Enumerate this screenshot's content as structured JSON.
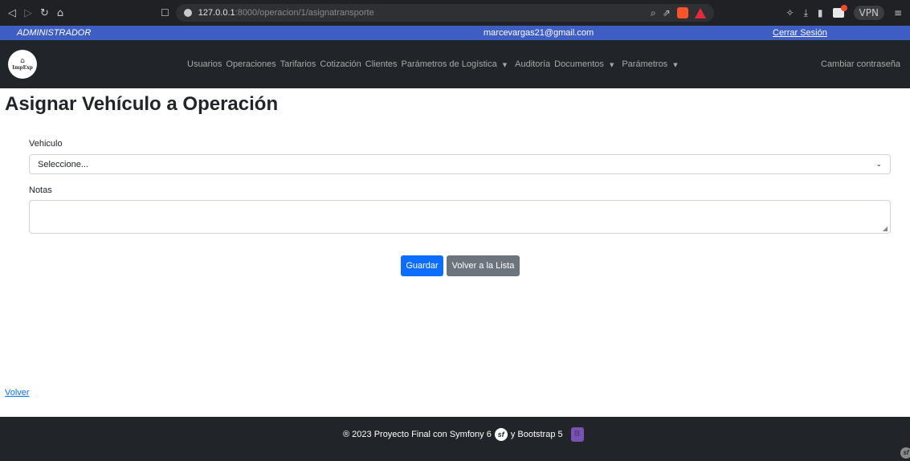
{
  "browser": {
    "url_host": "127.0.0.1",
    "url_path": ":8000/operacion/1/asignatransporte",
    "vpn_label": "VPN"
  },
  "topbar": {
    "role": "ADMINISTRADOR",
    "email": "marcevargas21@gmail.com",
    "logout_label": "Cerrar Sesión"
  },
  "navbar": {
    "logo_text": "ImpExp",
    "items": [
      {
        "label": "Usuarios"
      },
      {
        "label": "Operaciones"
      },
      {
        "label": "Tarifarios"
      },
      {
        "label": "Cotización"
      },
      {
        "label": "Clientes"
      },
      {
        "label": "Parámetros de Logística"
      },
      {
        "label": "Auditoría"
      },
      {
        "label": "Documentos"
      },
      {
        "label": "Parámetros"
      }
    ],
    "change_password": "Cambiar contraseña"
  },
  "page": {
    "title": "Asignar Vehículo a Operación"
  },
  "form": {
    "vehicle_label": "Vehiculo",
    "vehicle_selected": "Seleccione...",
    "notes_label": "Notas",
    "notes_value": "",
    "save_label": "Guardar",
    "back_to_list_label": "Volver a la Lista"
  },
  "back_link": "Volver",
  "footer": {
    "text_before": "® 2023 Proyecto Final con Symfony 6",
    "text_middle": "y Bootstrap 5"
  },
  "colors": {
    "topbar": "#3e5ec4",
    "navbar": "#212529",
    "primary": "#0d6efd",
    "secondary": "#6c757d"
  },
  "icons": [
    "back-icon",
    "forward-icon",
    "reload-icon",
    "home-icon",
    "bookmark-icon",
    "site-info-icon",
    "zoom-icon",
    "share-icon",
    "brave-shields-icon",
    "brave-rewards-icon",
    "extensions-icon",
    "download-icon",
    "sidebar-icon",
    "wallet-icon",
    "menu-icon",
    "symfony-icon",
    "bootstrap-icon",
    "caret-down-icon",
    "chevron-down-icon"
  ]
}
